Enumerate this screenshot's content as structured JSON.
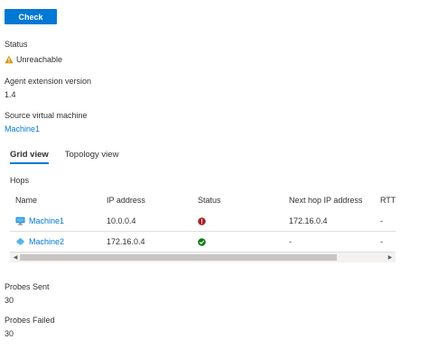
{
  "toolbar": {
    "check_label": "Check"
  },
  "status": {
    "label": "Status",
    "value": "Unreachable",
    "icon": "warning-icon",
    "icon_color": "#d89614"
  },
  "agent": {
    "label": "Agent extension version",
    "value": "1.4"
  },
  "source": {
    "label": "Source virtual machine",
    "value": "Machine1"
  },
  "tabs": [
    {
      "label": "Grid view",
      "active": true
    },
    {
      "label": "Topology view",
      "active": false
    }
  ],
  "hops": {
    "label": "Hops",
    "columns": [
      "Name",
      "IP address",
      "Status",
      "Next hop IP address",
      "RTT"
    ],
    "rows": [
      {
        "name": "Machine1",
        "ip": "10.0.0.4",
        "status": "error",
        "next_hop": "172.16.0.4",
        "rtt": "-"
      },
      {
        "name": "Machine2",
        "ip": "172.16.0.4",
        "status": "success",
        "next_hop": "-",
        "rtt": "-"
      }
    ]
  },
  "probes_sent": {
    "label": "Probes Sent",
    "value": "30"
  },
  "probes_failed": {
    "label": "Probes Failed",
    "value": "30"
  },
  "colors": {
    "accent": "#0078d4",
    "error": "#a4262c",
    "success": "#107c10",
    "warning": "#d89614"
  }
}
